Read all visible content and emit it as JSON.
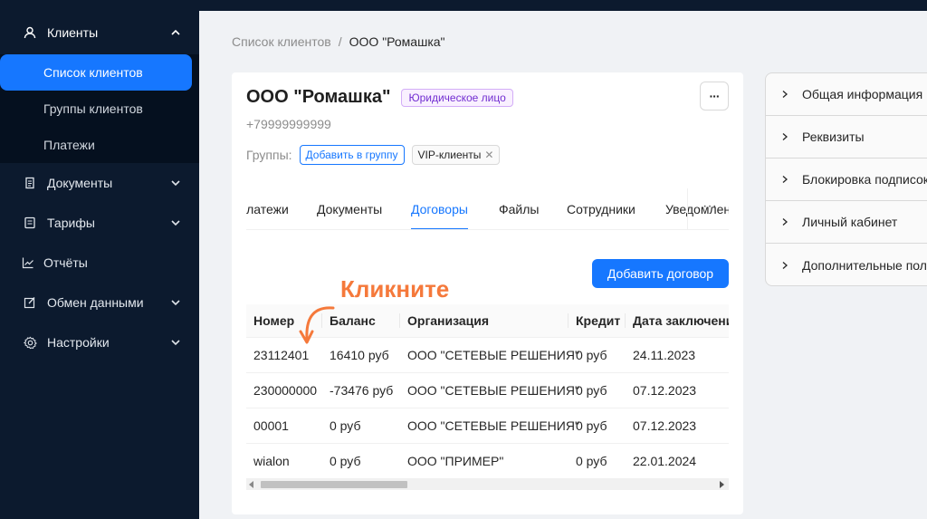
{
  "sidebar": {
    "items": [
      {
        "label": "Клиенты",
        "icon": "user-icon"
      },
      {
        "label": "Документы",
        "icon": "document-icon"
      },
      {
        "label": "Тарифы",
        "icon": "tariff-icon"
      },
      {
        "label": "Отчёты",
        "icon": "chart-icon"
      },
      {
        "label": "Обмен данными",
        "icon": "edit-icon"
      },
      {
        "label": "Настройки",
        "icon": "gear-icon"
      }
    ],
    "sub_items": [
      {
        "label": "Список клиентов"
      },
      {
        "label": "Группы клиентов"
      },
      {
        "label": "Платежи"
      }
    ]
  },
  "breadcrumb": {
    "parent": "Список клиентов",
    "separator": "/",
    "current": "ООО \"Ромашка\""
  },
  "client": {
    "name": "ООО \"Ромашка\"",
    "type_tag": "Юридическое лицо",
    "phone": "+79999999999",
    "groups_label": "Группы:",
    "add_group_label": "Добавить в группу",
    "group_tag": "VIP-клиенты",
    "more_label": "···"
  },
  "tabs": [
    {
      "label": "Платежи"
    },
    {
      "label": "Документы"
    },
    {
      "label": "Договоры"
    },
    {
      "label": "Файлы"
    },
    {
      "label": "Сотрудники"
    },
    {
      "label": "Уведомления"
    }
  ],
  "tabs_more": "···",
  "add_contract_label": "Добавить договор",
  "hint_text": "Кликните",
  "table": {
    "columns": [
      "Номер",
      "Баланс",
      "Организация",
      "Кредит",
      "Дата заключения"
    ],
    "rows": [
      [
        "23112401",
        "16410 руб",
        "ООО \"СЕТЕВЫЕ РЕШЕНИЯ\"",
        "0 руб",
        "24.11.2023"
      ],
      [
        "230000000",
        "-73476 руб",
        "ООО \"СЕТЕВЫЕ РЕШЕНИЯ\"",
        "0 руб",
        "07.12.2023"
      ],
      [
        "00001",
        "0 руб",
        "ООО \"СЕТЕВЫЕ РЕШЕНИЯ\"",
        "0 руб",
        "07.12.2023"
      ],
      [
        "wialon",
        "0 руб",
        "ООО \"ПРИМЕР\"",
        "0 руб",
        "22.01.2024"
      ]
    ]
  },
  "panel": {
    "items": [
      {
        "label": "Общая информация"
      },
      {
        "label": "Реквизиты"
      },
      {
        "label": "Блокировка подписок"
      },
      {
        "label": "Личный кабинет"
      },
      {
        "label": "Дополнительные поля"
      }
    ]
  },
  "colors": {
    "sidebar_bg": "#0c1a2e",
    "accent": "#1677ff",
    "hint": "#f5793b",
    "tag_purple": "#722ed1"
  }
}
